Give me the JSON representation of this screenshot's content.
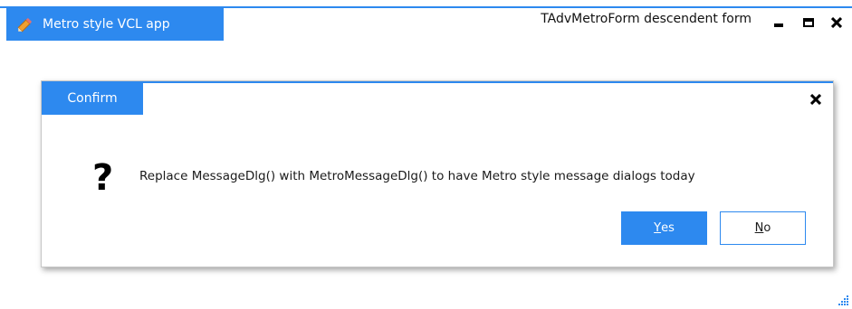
{
  "app": {
    "tab_label": "Metro style VCL app",
    "window_title": "TAdvMetroForm descendent form",
    "icon": "pencil-icon",
    "controls": [
      "minimize-icon",
      "maximize-icon",
      "close-icon"
    ]
  },
  "dialog": {
    "tab_label": "Confirm",
    "message": "Replace MessageDlg() with MetroMessageDlg() to have Metro style message dialogs today",
    "question_glyph": "?",
    "buttons": {
      "yes_hotkey": "Y",
      "yes_rest": "es",
      "no_hotkey": "N",
      "no_rest": "o"
    }
  },
  "colors": {
    "accent": "#2d89ef",
    "text": "#1a1a1a",
    "background": "#ffffff"
  }
}
